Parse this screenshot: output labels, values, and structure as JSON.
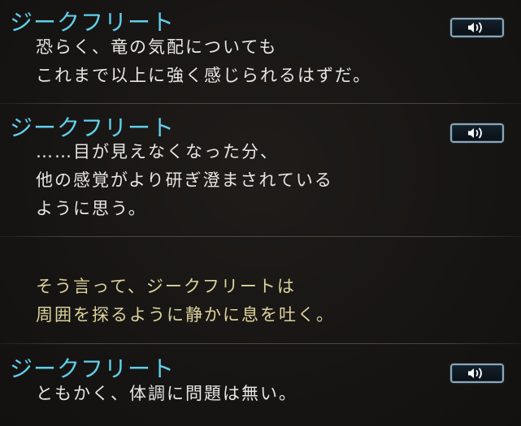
{
  "entries": [
    {
      "speaker": "ジークフリート",
      "lines": [
        "恐らく、竜の気配についても",
        "これまで以上に強く感じられるはずだ。"
      ]
    },
    {
      "speaker": "ジークフリート",
      "lines": [
        "……目が見えなくなった分、",
        "他の感覚がより研ぎ澄まされている",
        "ように思う。"
      ]
    },
    {
      "speaker": "",
      "lines": [
        "そう言って、ジークフリートは",
        "周囲を探るように静かに息を吐く。"
      ]
    },
    {
      "speaker": "ジークフリート",
      "lines": [
        "ともかく、体調に問題は無い。"
      ]
    }
  ],
  "icons": {
    "voice_button": "speaker-icon"
  },
  "colors": {
    "speaker_name": "#5fd0ec",
    "dialogue_text": "#e8e6e2",
    "narration_text": "#ddd39a",
    "background": "#171513",
    "voice_button_border": "#8aa6b8"
  }
}
